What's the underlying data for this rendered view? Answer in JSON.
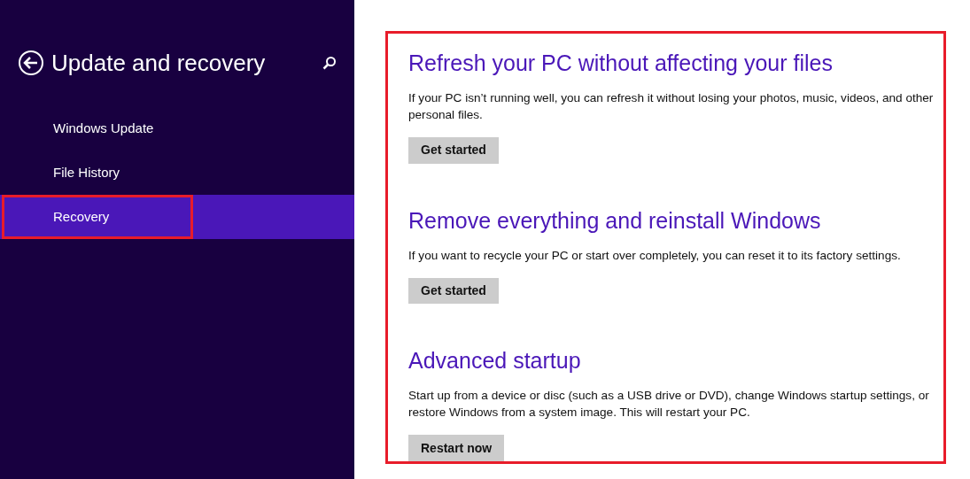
{
  "sidebar": {
    "title": "Update and recovery",
    "items": [
      {
        "label": "Windows Update",
        "selected": false,
        "outlined": false
      },
      {
        "label": "File History",
        "selected": false,
        "outlined": false
      },
      {
        "label": "Recovery",
        "selected": true,
        "outlined": true
      }
    ]
  },
  "content": {
    "outlined": true,
    "sections": [
      {
        "heading": "Refresh your PC without affecting your files",
        "text": "If your PC isn’t running well, you can refresh it without losing your photos, music, videos, and other personal files.",
        "button": "Get started"
      },
      {
        "heading": "Remove everything and reinstall Windows",
        "text": "If you want to recycle your PC or start over completely, you can reset it to its factory settings.",
        "button": "Get started"
      },
      {
        "heading": "Advanced startup",
        "text": "Start up from a device or disc (such as a USB drive or DVD), change Windows startup settings, or restore Windows from a system image. This will restart your PC.",
        "button": "Restart now"
      }
    ]
  }
}
